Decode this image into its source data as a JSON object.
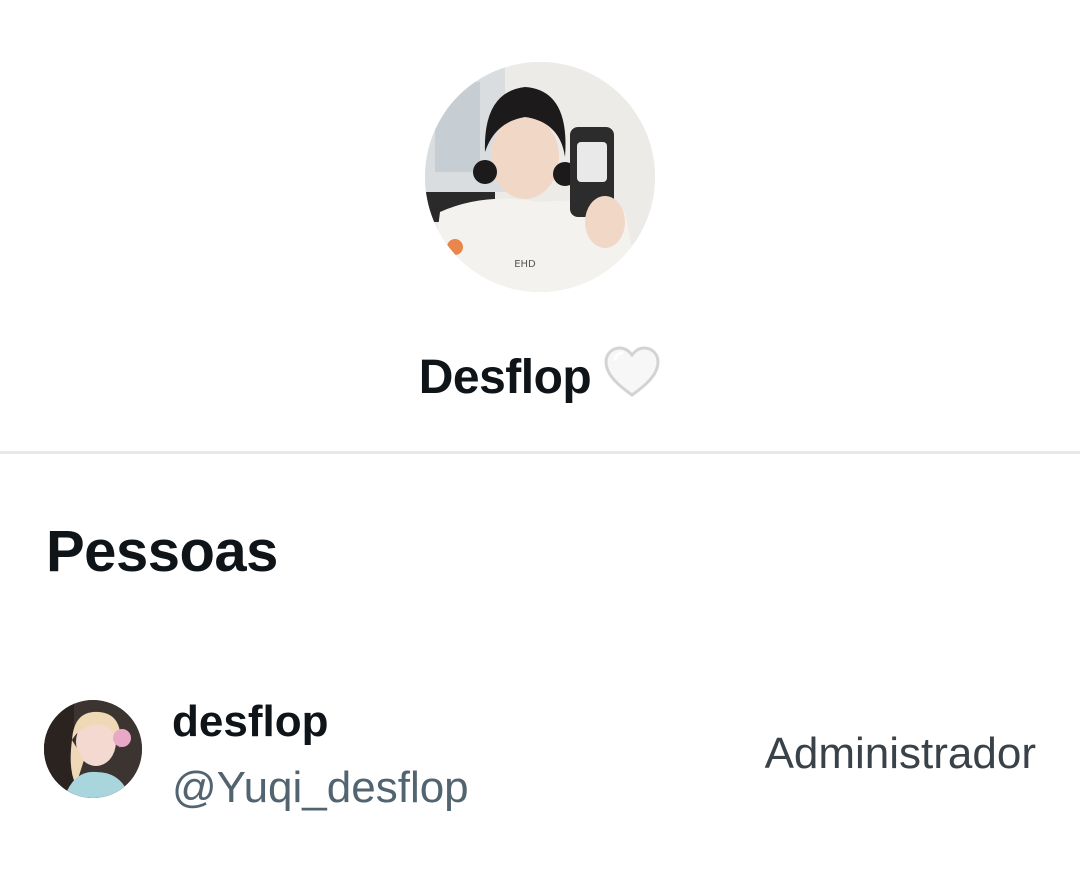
{
  "conversation": {
    "title": "Desflop",
    "title_emoji": "white-heart-icon",
    "avatar": "group-avatar-image"
  },
  "people_section": {
    "title": "Pessoas",
    "members": [
      {
        "name": "desflop",
        "handle": "@Yuqi_desflop",
        "role": "Administrador",
        "avatar": "member-avatar-image"
      }
    ]
  },
  "colors": {
    "text_primary": "#0f1419",
    "text_secondary": "#536471",
    "divider": "#e6e8ea",
    "background": "#ffffff"
  }
}
